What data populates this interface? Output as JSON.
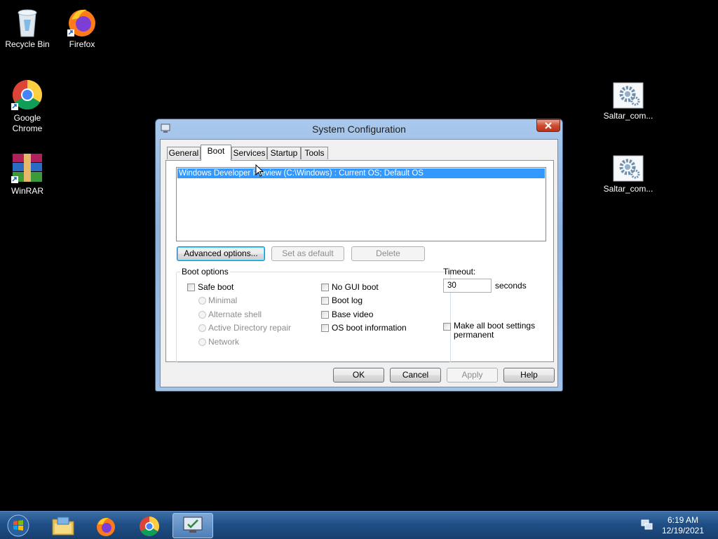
{
  "desktop": {
    "icons": [
      {
        "label": "Recycle Bin",
        "icon": "recycle-bin-icon"
      },
      {
        "label": "Firefox",
        "icon": "firefox-icon"
      },
      {
        "label": "Google Chrome",
        "icon": "chrome-icon"
      },
      {
        "label": "WinRAR",
        "icon": "winrar-icon"
      },
      {
        "label": "Saltar_com...",
        "icon": "settings-shortcut-icon"
      },
      {
        "label": "Saltar_com...",
        "icon": "settings-shortcut-icon"
      }
    ]
  },
  "window": {
    "title": "System Configuration",
    "tabs": [
      "General",
      "Boot",
      "Services",
      "Startup",
      "Tools"
    ],
    "active_tab": "Boot",
    "boot_entries": [
      "Windows Developer Preview (C:\\Windows) : Current OS; Default OS"
    ],
    "buttons": {
      "advanced": "Advanced options...",
      "set_default": "Set as default",
      "delete": "Delete"
    },
    "boot_options": {
      "title": "Boot options",
      "safe_boot": "Safe boot",
      "minimal": "Minimal",
      "alternate_shell": "Alternate shell",
      "ad_repair": "Active Directory repair",
      "network": "Network",
      "no_gui": "No GUI boot",
      "boot_log": "Boot log",
      "base_video": "Base video",
      "os_boot_info": "OS boot information"
    },
    "timeout": {
      "label": "Timeout:",
      "value": "30",
      "unit": "seconds"
    },
    "make_permanent": {
      "line1": "Make all boot settings",
      "line2": "permanent"
    },
    "dialog_buttons": {
      "ok": "OK",
      "cancel": "Cancel",
      "apply": "Apply",
      "help": "Help"
    }
  },
  "taskbar": {
    "items": [
      "start-orb-icon",
      "file-explorer-icon",
      "firefox-icon",
      "chrome-icon",
      "msconfig-icon"
    ],
    "time": "6:19 AM",
    "date": "12/19/2021"
  },
  "colors": {
    "selection": "#3399ff",
    "taskbar": "#1f4f86",
    "desktop": "#000000"
  }
}
